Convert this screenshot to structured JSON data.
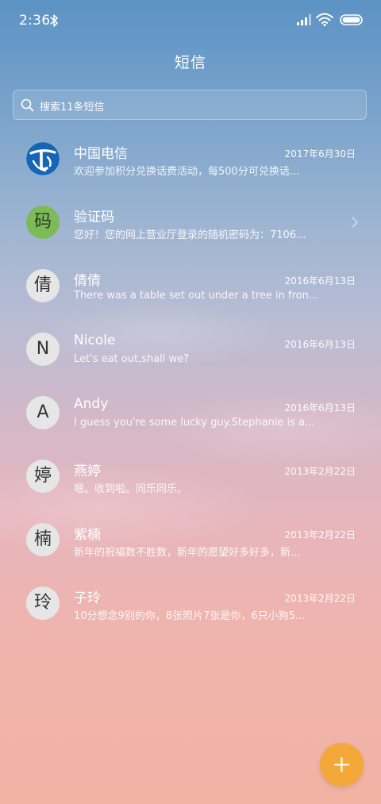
{
  "status_bar": {
    "time": "2:36",
    "icons": [
      "bluetooth-icon",
      "signal-icon",
      "wifi-icon",
      "battery-icon"
    ]
  },
  "header": {
    "title": "短信"
  },
  "search": {
    "placeholder": "搜索11条短信",
    "icon": "search-icon"
  },
  "messages": [
    {
      "avatar": "china-telecom-logo",
      "name": "中国电信",
      "date": "2017年6月30日",
      "preview": "欢迎参加积分兑换话费活动，每500分可兑换话..."
    },
    {
      "avatar": "码",
      "name": "验证码",
      "date": "",
      "preview": "您好！您的网上营业厅登录的随机密码为：7106...",
      "icon": "chevron-right-icon",
      "avatar_color": "#7cbb58"
    },
    {
      "avatar": "倩",
      "name": "倩倩",
      "date": "2016年6月13日",
      "preview": "There was a table set out under a tree in fron..."
    },
    {
      "avatar": "N",
      "name": "Nicole",
      "date": "2016年6月13日",
      "preview": "Let's eat out,shall we?"
    },
    {
      "avatar": "A",
      "name": "Andy",
      "date": "2016年6月13日",
      "preview": "I guess you're some lucky guy.Stephanie is a..."
    },
    {
      "avatar": "婷",
      "name": "燕婷",
      "date": "2013年2月22日",
      "preview": "嗯。收到啦。同乐同乐。"
    },
    {
      "avatar": "楠",
      "name": "紫楠",
      "date": "2013年2月22日",
      "preview": "新年的祝福数不胜数，新年的愿望好多好多，新..."
    },
    {
      "avatar": "玲",
      "name": "子玲",
      "date": "2013年2月22日",
      "preview": "10分想念9别的你，8张照片7张是你，6只小狗5..."
    }
  ],
  "fab": {
    "icon": "plus-icon",
    "color": "#f5a83a"
  }
}
